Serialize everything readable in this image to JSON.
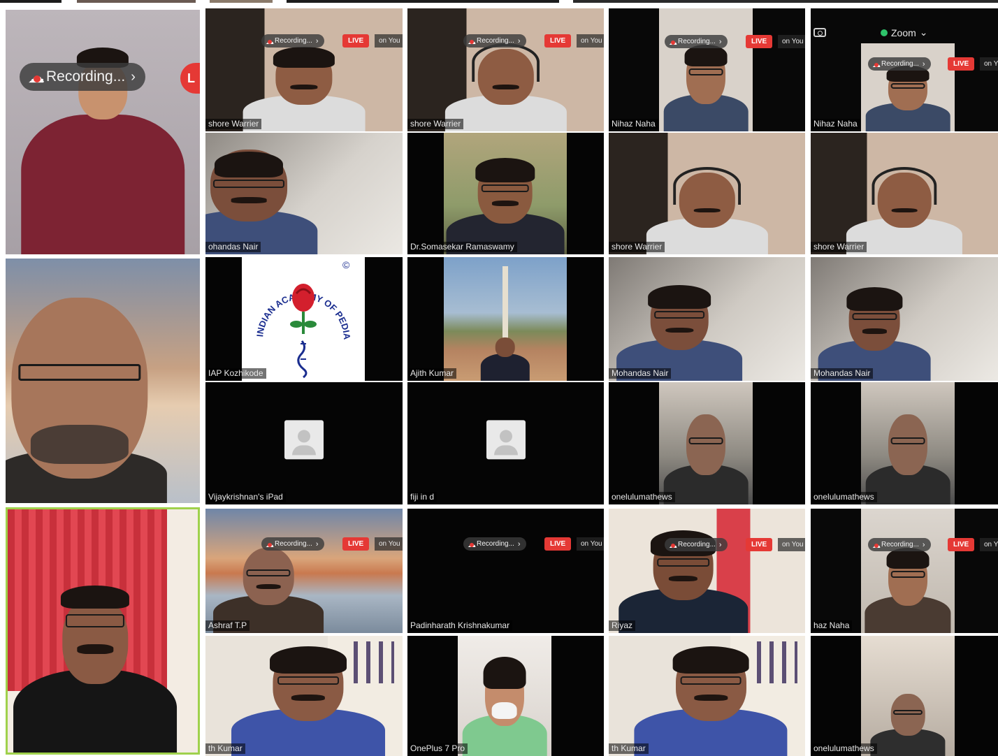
{
  "recording": {
    "label": "Recording...",
    "chevron": "›",
    "icon": "cloud-recording-icon"
  },
  "live_badge": "LIVE",
  "live_badge_big": "L",
  "on_you": "on You",
  "zoom_menu": {
    "label": "Zoom",
    "chevron": "⌄"
  },
  "iap_logo": {
    "arc_text": "INDIAN ACADEMY OF PEDIATRICS",
    "copyright": "©"
  },
  "tiles": {
    "r1c2": "shore Warrier",
    "r1c3": "shore Warrier",
    "r1c4": "Nihaz Naha",
    "r1c5": "Nihaz Naha",
    "r2c2": "ohandas Nair",
    "r2c3": "Dr.Somasekar Ramaswamy",
    "r2c4": "shore Warrier",
    "r2c5": "shore Warrier",
    "r3c2": "IAP Kozhikode",
    "r3c3": "Ajith Kumar",
    "r3c4": "Mohandas Nair",
    "r3c5": "Mohandas Nair",
    "r4c2": "Vijaykrishnan's iPad",
    "r4c3": "fiji in d",
    "r4c4": "onelulumathews",
    "r4c5": "onelulumathews",
    "r5c2": "Ashraf T.P",
    "r5c3": "Padinharath Krishnakumar",
    "r5c4": "Riyaz",
    "r5c5": "haz Naha",
    "r6c2": "th Kumar",
    "r6c3": "OnePlus 7 Pro",
    "r6c4": "th Kumar",
    "r6c5": "onelulumathews"
  }
}
